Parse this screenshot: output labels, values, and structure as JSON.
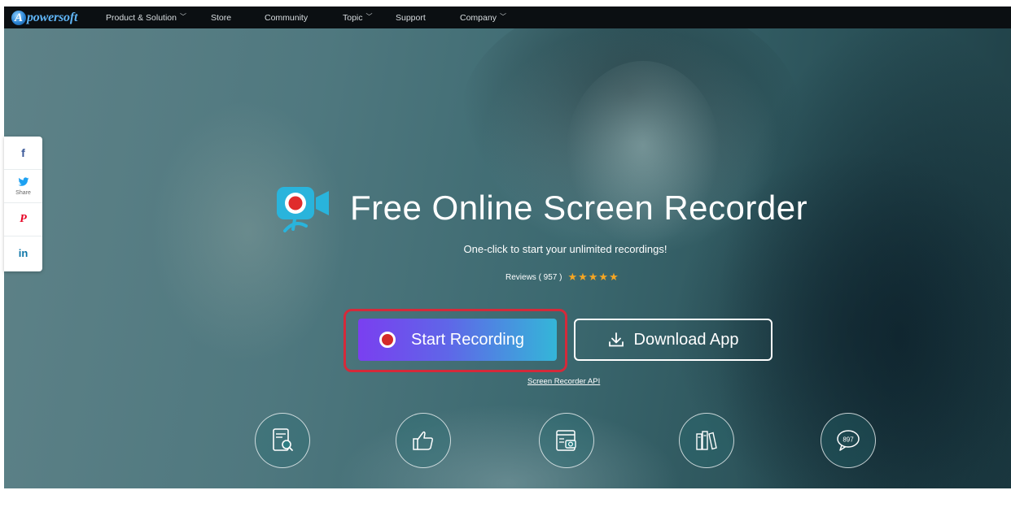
{
  "nav": {
    "logo_initial": "A",
    "logo_text": "powersoft",
    "items": [
      {
        "label": "Product & Solution",
        "dropdown": true
      },
      {
        "label": "Store",
        "dropdown": false
      },
      {
        "label": "Community",
        "dropdown": false
      },
      {
        "label": "Topic",
        "dropdown": true
      },
      {
        "label": "Support",
        "dropdown": false
      },
      {
        "label": "Company",
        "dropdown": true
      }
    ]
  },
  "share": {
    "label": "Share",
    "buttons": [
      {
        "icon": "facebook-icon",
        "glyph": "f",
        "color": "#3b5998"
      },
      {
        "icon": "twitter-icon",
        "glyph": "🐦",
        "color": "#1da1f2"
      },
      {
        "icon": "pinterest-icon",
        "glyph": "P",
        "color": "#e60023"
      },
      {
        "icon": "linkedin-icon",
        "glyph": "in",
        "color": "#0e76a8"
      }
    ]
  },
  "hero": {
    "title": "Free Online Screen Recorder",
    "subtitle": "One-click to start your unlimited recordings!",
    "reviews_label": "Reviews ( 957 )",
    "rating_stars": 5,
    "start_button": "Start Recording",
    "download_button": "Download App",
    "api_link": "Screen Recorder API",
    "highlight_color": "#d42a3a"
  },
  "features": [
    {
      "icon": "document-search-icon"
    },
    {
      "icon": "thumbs-up-icon"
    },
    {
      "icon": "screenshot-camera-icon"
    },
    {
      "icon": "books-icon"
    },
    {
      "icon": "comment-count-icon",
      "count": "897"
    }
  ],
  "colors": {
    "nav_bg": "#0b0f12",
    "hero_bg": "#3c6970",
    "start_gradient_start": "#7a3ff0",
    "start_gradient_end": "#34b6d8",
    "star": "#f6a623"
  }
}
